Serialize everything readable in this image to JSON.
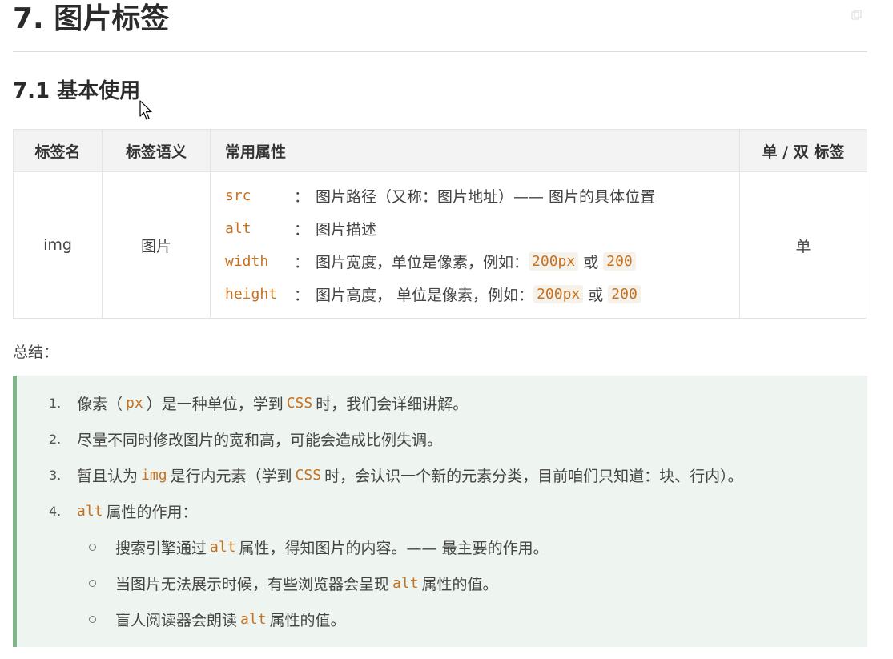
{
  "heading1": "7. 图片标签",
  "heading2": "7.1 基本使用",
  "table": {
    "headers": [
      "标签名",
      "标签语义",
      "常用属性",
      "单 / 双 标签"
    ],
    "row": {
      "tag": "img",
      "meaning": "图片",
      "attributes": [
        {
          "name": "src",
          "sep": "：",
          "desc": "图片路径（又称：图片地址）—— 图片的具体位置"
        },
        {
          "name": "alt",
          "sep": "：",
          "desc": "图片描述"
        },
        {
          "name": "width",
          "sep": "：",
          "desc": "图片宽度，单位是像素，例如：",
          "v1": "200px",
          "or": "或",
          "v2": "200"
        },
        {
          "name": "height",
          "sep": "：",
          "desc": "图片高度， 单位是像素，例如：",
          "v1": "200px",
          "or": "或",
          "v2": "200"
        }
      ],
      "type": "单"
    }
  },
  "summary_title": "总结：",
  "summary": {
    "item1": {
      "num": "1.",
      "a": "像素（",
      "code": "px",
      "b": "）是一种单位，学到",
      "code2": "CSS",
      "c": "时，我们会详细讲解。"
    },
    "item2": {
      "num": "2.",
      "text": "尽量不同时修改图片的宽和高，可能会造成比例失调。"
    },
    "item3": {
      "num": "3.",
      "a": "暂且认为",
      "code": "img",
      "b": "是行内元素（学到",
      "code2": "CSS",
      "c": "时，会认识一个新的元素分类，目前咱们只知道：块、行内）。"
    },
    "item4": {
      "num": "4.",
      "code": "alt",
      "a": "属性的作用："
    },
    "sub1": {
      "a": "搜索引擎通过",
      "code": "alt",
      "b": "属性，得知图片的内容。—— 最主要的作用。"
    },
    "sub2": {
      "a": "当图片无法展示时候，有些浏览器会呈现",
      "code": "alt",
      "b": "属性的值。"
    },
    "sub3": {
      "a": "盲人阅读器会朗读",
      "code": "alt",
      "b": "属性的值。"
    }
  }
}
